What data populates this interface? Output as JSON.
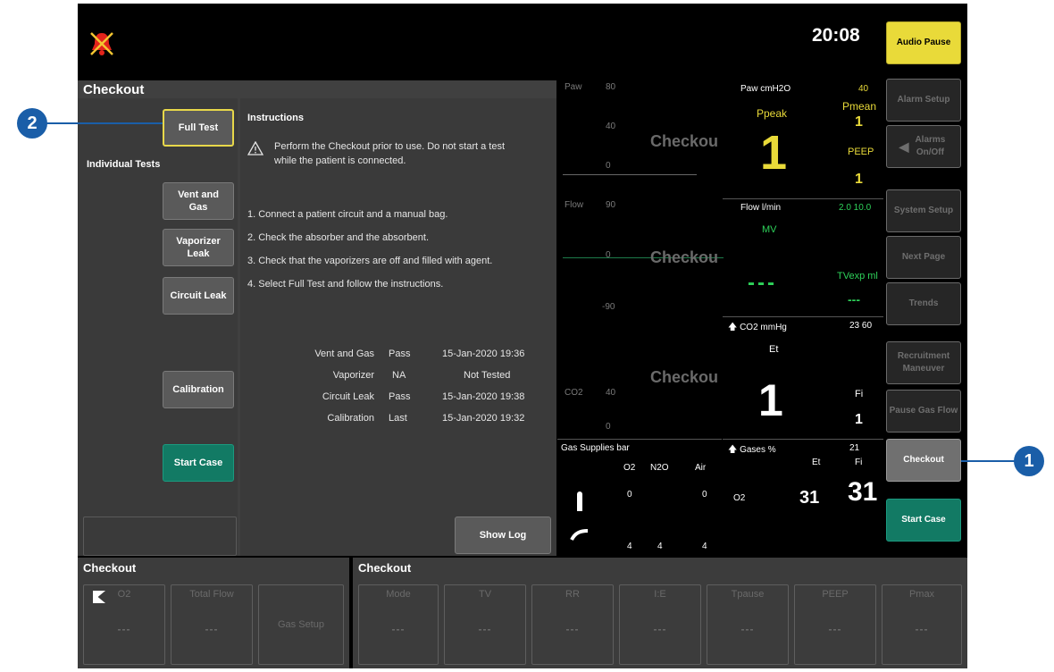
{
  "topbar": {
    "time": "20:08"
  },
  "softkeys": [
    {
      "label": "Audio Pause"
    },
    {
      "label": "Alarm Setup"
    },
    {
      "label": "Alarms On/Off"
    },
    {
      "label": "System Setup"
    },
    {
      "label": "Next Page"
    },
    {
      "label": "Trends"
    },
    {
      "label": "Recruitment Maneuver"
    },
    {
      "label": "Pause Gas Flow"
    },
    {
      "label": "Checkout"
    },
    {
      "label": "Start Case"
    }
  ],
  "checkout": {
    "title": "Checkout",
    "full_test": "Full Test",
    "individual_tests": "Individual Tests",
    "vent_gas": "Vent and Gas",
    "vaporizer_leak": "Vaporizer Leak",
    "circuit_leak": "Circuit Leak",
    "calibration": "Calibration",
    "start_case": "Start Case",
    "show_log": "Show Log",
    "instructions_title": "Instructions",
    "warning_text_1": "Perform the Checkout prior to use. Do not start a test",
    "warning_text_2": "while the patient is connected.",
    "steps": [
      "1. Connect a patient circuit and a manual bag.",
      "2. Check the absorber and the absorbent.",
      "3. Check that the vaporizers are off and filled with agent.",
      "4. Select Full Test and follow the instructions."
    ],
    "results": [
      {
        "test": "Vent and Gas",
        "status": "Pass",
        "date": "15-Jan-2020 19:36"
      },
      {
        "test": "Vaporizer",
        "status": "NA",
        "date": "Not Tested"
      },
      {
        "test": "Circuit Leak",
        "status": "Pass",
        "date": "15-Jan-2020 19:38"
      },
      {
        "test": "Calibration",
        "status": "Last",
        "date": "15-Jan-2020 19:32"
      }
    ]
  },
  "waveforms": {
    "paw": {
      "label": "Paw",
      "top": "80",
      "mid": "40",
      "bot": "0",
      "mark": "Checkou"
    },
    "flow": {
      "label": "Flow",
      "top": "90",
      "mid": "0",
      "bot": "-90",
      "mark": "Checkou"
    },
    "co2": {
      "label": "CO2",
      "top": "40",
      "bot": "0",
      "mark": "Checkou"
    }
  },
  "params": {
    "paw_title": "Paw cmH2O",
    "paw_alarm": "40",
    "ppeak_label": "Ppeak",
    "ppeak_value": "1",
    "pmean_label": "Pmean",
    "pmean_value": "1",
    "peep_label": "PEEP",
    "peep_value": "1",
    "flow_title": "Flow l/min",
    "flow_alarm": "2.0 10.0",
    "mv_label": "MV",
    "mv_value": "---",
    "tvexp_label": "TVexp ml",
    "tvexp_value": "---",
    "co2_title": "CO2 mmHg",
    "co2_alarm": "23 60",
    "et_label": "Et",
    "et_value": "1",
    "fi_label": "Fi",
    "fi_value": "1",
    "gases_title": "Gases %",
    "gases_alarm": "21",
    "gas_et": "Et",
    "gas_fi": "Fi",
    "o2_label": "O2",
    "o2_et": "31",
    "o2_fi": "31"
  },
  "gas_supplies": {
    "title": "Gas Supplies bar",
    "headers": [
      "O2",
      "N2O",
      "Air"
    ],
    "row1": [
      "0",
      "",
      "0"
    ],
    "row2": [
      "4",
      "4",
      "4"
    ]
  },
  "bottom_left": {
    "title": "Checkout",
    "cells": [
      {
        "label": "O2",
        "value": "---"
      },
      {
        "label": "Total Flow",
        "value": "---"
      },
      {
        "label": "Gas Setup",
        "value": ""
      }
    ]
  },
  "bottom_right": {
    "title": "Checkout",
    "cells": [
      {
        "label": "Mode",
        "value": "---"
      },
      {
        "label": "TV",
        "value": "---"
      },
      {
        "label": "RR",
        "value": "---"
      },
      {
        "label": "I:E",
        "value": "---"
      },
      {
        "label": "Tpause",
        "value": "---"
      },
      {
        "label": "PEEP",
        "value": "---"
      },
      {
        "label": "Pmax",
        "value": "---"
      }
    ]
  },
  "callouts": {
    "one": "1",
    "two": "2"
  },
  "colors": {
    "accent_yellow": "#e9da39",
    "accent_green": "#127a64",
    "callout_blue": "#1a5ea8"
  }
}
